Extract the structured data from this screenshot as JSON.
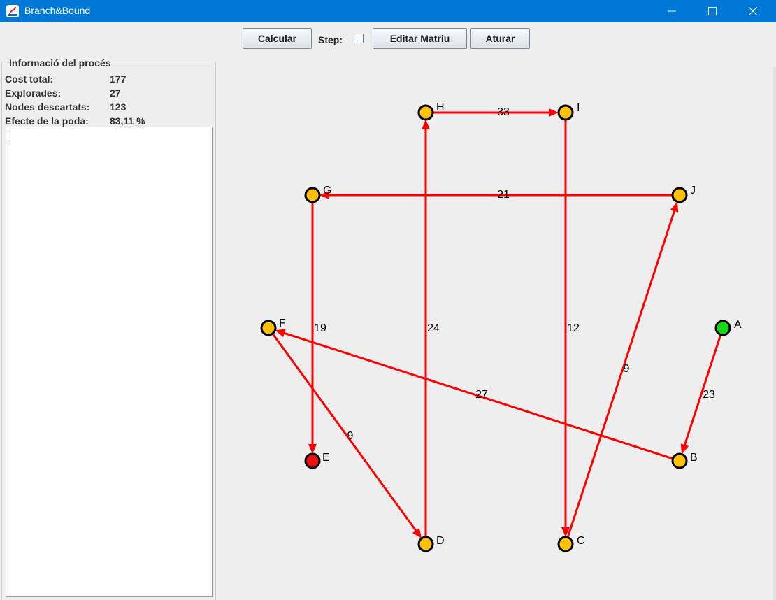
{
  "window": {
    "title": "Branch&Bound"
  },
  "toolbar": {
    "calcular_label": "Calcular",
    "step_label": "Step:",
    "step_checked": false,
    "editar_label": "Editar Matriu",
    "aturar_label": "Aturar"
  },
  "info": {
    "legend": "Informació del procés",
    "stats": [
      {
        "label": "Cost total:",
        "value": "177"
      },
      {
        "label": "Explorades:",
        "value": "27"
      },
      {
        "label": "Nodes descartats:",
        "value": "123"
      },
      {
        "label": "Efecte de la poda:",
        "value": "83,11 %"
      }
    ],
    "log_text": ""
  },
  "graph": {
    "colors": {
      "edge": "#ff0000",
      "node_default": "#ffc107",
      "node_start": "#16d616",
      "node_end": "#ee1111",
      "node_border": "#000000"
    },
    "nodes": [
      {
        "id": "A",
        "label": "A",
        "role": "start"
      },
      {
        "id": "B",
        "label": "B",
        "role": "default"
      },
      {
        "id": "C",
        "label": "C",
        "role": "default"
      },
      {
        "id": "D",
        "label": "D",
        "role": "default"
      },
      {
        "id": "E",
        "label": "E",
        "role": "end"
      },
      {
        "id": "F",
        "label": "F",
        "role": "default"
      },
      {
        "id": "G",
        "label": "G",
        "role": "default"
      },
      {
        "id": "H",
        "label": "H",
        "role": "default"
      },
      {
        "id": "I",
        "label": "I",
        "role": "default"
      },
      {
        "id": "J",
        "label": "J",
        "role": "default"
      }
    ],
    "edges": [
      {
        "from": "A",
        "to": "B",
        "weight": "23"
      },
      {
        "from": "B",
        "to": "F",
        "weight": "27"
      },
      {
        "from": "F",
        "to": "D",
        "weight": "9"
      },
      {
        "from": "D",
        "to": "H",
        "weight": "24"
      },
      {
        "from": "H",
        "to": "I",
        "weight": "33"
      },
      {
        "from": "I",
        "to": "C",
        "weight": "12"
      },
      {
        "from": "C",
        "to": "J",
        "weight": "9"
      },
      {
        "from": "J",
        "to": "G",
        "weight": "21"
      },
      {
        "from": "G",
        "to": "E",
        "weight": "19"
      }
    ]
  }
}
